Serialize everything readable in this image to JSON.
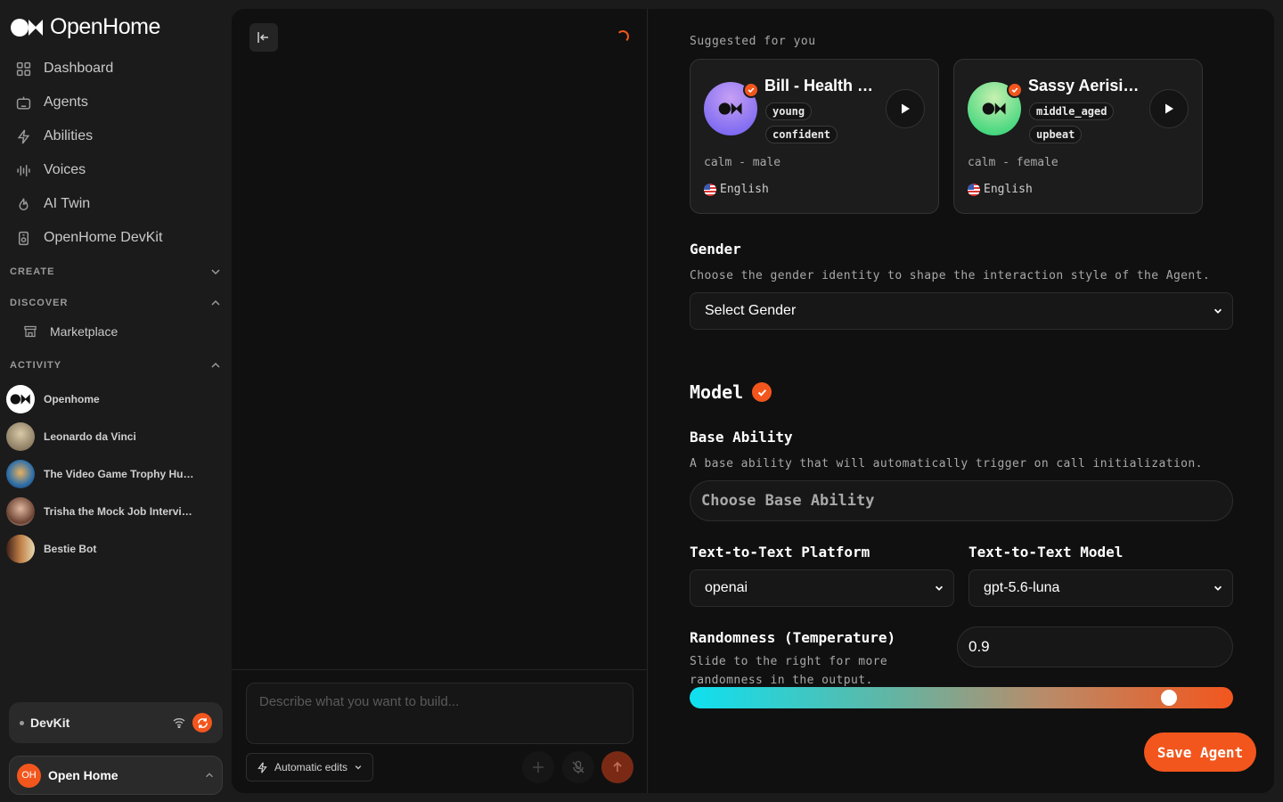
{
  "app": {
    "name": "OpenHome"
  },
  "sidebar": {
    "nav": [
      {
        "label": "Dashboard",
        "icon": "grid-icon"
      },
      {
        "label": "Agents",
        "icon": "robot-icon"
      },
      {
        "label": "Abilities",
        "icon": "bolt-icon"
      },
      {
        "label": "Voices",
        "icon": "waveform-icon"
      },
      {
        "label": "AI Twin",
        "icon": "flame-icon"
      },
      {
        "label": "OpenHome DevKit",
        "icon": "device-icon"
      }
    ],
    "sections": {
      "create": "CREATE",
      "discover": "DISCOVER",
      "activity": "ACTIVITY"
    },
    "marketplace": "Marketplace",
    "activity": [
      {
        "name": "Openhome",
        "avatar_color": "#ffffff"
      },
      {
        "name": "Leonardo da Vinci",
        "avatar_color": "#8a7a62"
      },
      {
        "name": "The Video Game Trophy Hu…",
        "avatar_color": "#2d6fa8"
      },
      {
        "name": "Trisha the Mock Job Intervi…",
        "avatar_color": "#9a7058"
      },
      {
        "name": "Bestie Bot",
        "avatar_color": "#b0703a"
      }
    ],
    "devkit": {
      "label": "DevKit"
    },
    "user": {
      "initials": "OH",
      "name": "Open Home"
    }
  },
  "chat": {
    "prompt_placeholder": "Describe what you want to build...",
    "auto_edits_label": "Automatic edits"
  },
  "config": {
    "suggested_label": "Suggested for you",
    "voices": [
      {
        "name": "Bill - Health …",
        "tags": [
          "young",
          "confident"
        ],
        "desc": "calm - male",
        "lang": "English",
        "avatar_gradient": [
          "#6a5cf0",
          "#c7a0f5"
        ]
      },
      {
        "name": "Sassy Aerisi…",
        "tags": [
          "middle_aged",
          "upbeat"
        ],
        "desc": "calm - female",
        "lang": "English",
        "avatar_gradient": [
          "#20d070",
          "#c8f0b0"
        ]
      }
    ],
    "gender": {
      "title": "Gender",
      "desc": "Choose the gender identity to shape the interaction style of the Agent.",
      "value": "Select Gender"
    },
    "model": {
      "title": "Model"
    },
    "base_ability": {
      "title": "Base Ability",
      "desc": "A base ability that will automatically trigger on call initialization.",
      "placeholder": "Choose Base Ability"
    },
    "platform": {
      "title": "Text-to-Text Platform",
      "value": "openai"
    },
    "ttmodel": {
      "title": "Text-to-Text Model",
      "value": "gpt-5.6-luna"
    },
    "temperature": {
      "title": "Randomness (Temperature)",
      "desc": "Slide to the right for more randomness in the output.",
      "value": "0.9",
      "fraction": 0.9
    },
    "save_label": "Save Agent"
  },
  "colors": {
    "accent": "#f2561d",
    "panel": "#101010",
    "sidebar": "#1b1b1b"
  }
}
